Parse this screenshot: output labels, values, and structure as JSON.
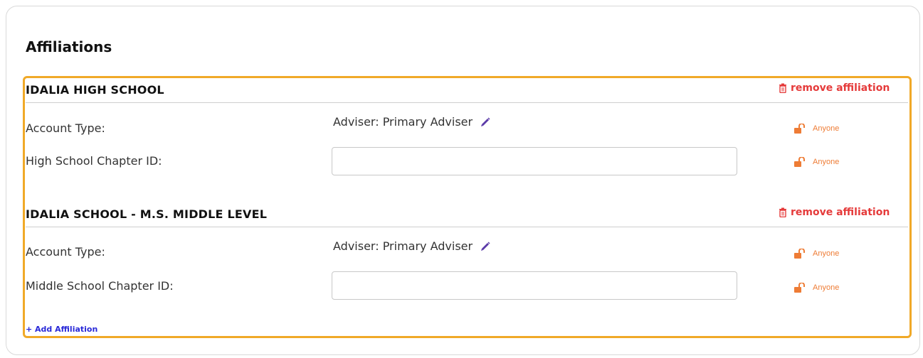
{
  "section": {
    "title": "Affiliations"
  },
  "affiliations": [
    {
      "name": "IDALIA HIGH SCHOOL",
      "remove_label": "remove affiliation",
      "account_type_label": "Account Type:",
      "account_type_value": "Adviser: Primary Adviser",
      "chapter_label": "High School Chapter ID:",
      "chapter_value": "",
      "privacy_account": "Anyone",
      "privacy_chapter": "Anyone"
    },
    {
      "name": "IDALIA SCHOOL - M.S. MIDDLE LEVEL",
      "remove_label": "remove affiliation",
      "account_type_label": "Account Type:",
      "account_type_value": "Adviser: Primary Adviser",
      "chapter_label": "Middle School Chapter ID:",
      "chapter_value": "",
      "privacy_account": "Anyone",
      "privacy_chapter": "Anyone"
    }
  ],
  "add_affiliation_label": "+ Add Affiliation",
  "icons": {
    "remove": "trash-icon",
    "edit": "pencil-icon",
    "privacy": "unlocked-padlock-icon"
  },
  "colors": {
    "highlight": "#f0a928",
    "remove": "#e53b3b",
    "privacy": "#ee7c35",
    "link": "#2a2ad8",
    "pencil": "#5b3aa8"
  }
}
